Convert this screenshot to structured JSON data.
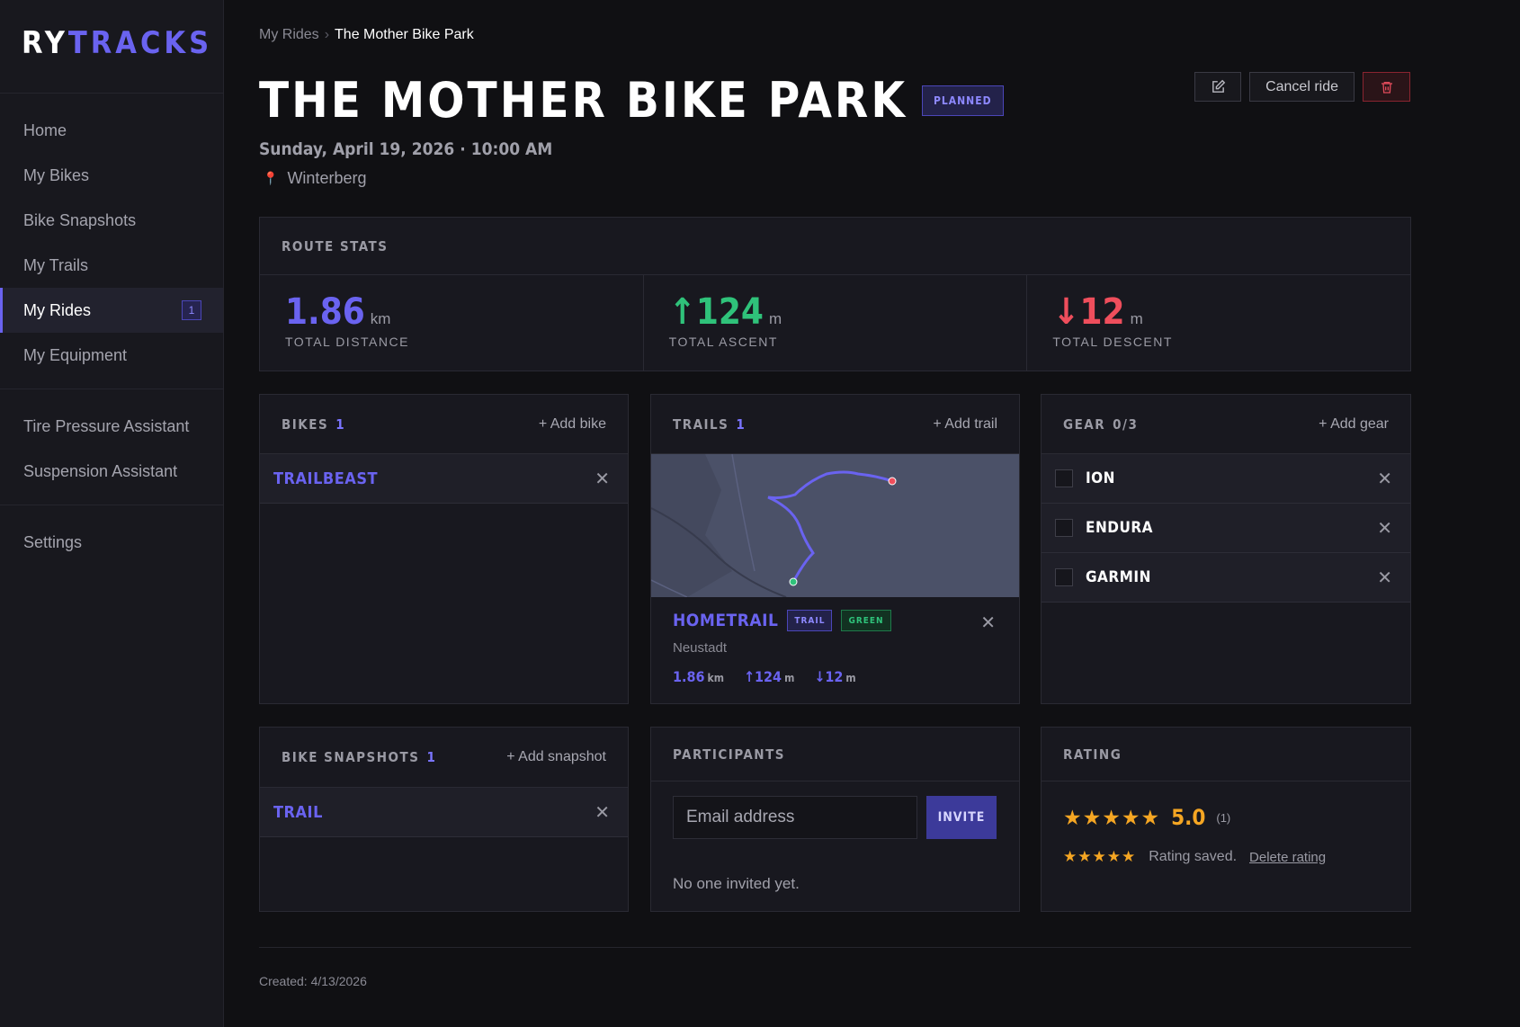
{
  "app": {
    "logo_part1": "RY",
    "logo_part2": "TRACKS"
  },
  "sidebar": {
    "items": [
      {
        "label": "Home"
      },
      {
        "label": "My Bikes"
      },
      {
        "label": "Bike Snapshots"
      },
      {
        "label": "My Trails"
      },
      {
        "label": "My Rides",
        "badge": "1",
        "active": true
      },
      {
        "label": "My Equipment"
      },
      {
        "label": "Tire Pressure Assistant"
      },
      {
        "label": "Suspension Assistant"
      },
      {
        "label": "Settings"
      }
    ]
  },
  "breadcrumb": {
    "parent": "My Rides",
    "separator": "›",
    "current": "The Mother Bike Park"
  },
  "ride": {
    "title": "THE MOTHER BIKE PARK",
    "status": "PLANNED",
    "date": "Sunday, April 19, 2026 · 10:00 AM",
    "location": "Winterberg"
  },
  "actions": {
    "cancel_label": "Cancel ride",
    "edit_icon": "edit-icon",
    "delete_icon": "trash-icon"
  },
  "route_stats": {
    "title": "ROUTE STATS",
    "distance": {
      "value": "1.86",
      "unit": "km",
      "label": "TOTAL DISTANCE"
    },
    "ascent": {
      "arrow": "↑",
      "value": "124",
      "unit": "m",
      "label": "TOTAL ASCENT"
    },
    "descent": {
      "arrow": "↓",
      "value": "12",
      "unit": "m",
      "label": "TOTAL DESCENT"
    }
  },
  "bikes": {
    "title": "BIKES",
    "count": "1",
    "add_label": "+ Add bike",
    "items": [
      {
        "name": "TRAILBEAST"
      }
    ]
  },
  "trails": {
    "title": "TRAILS",
    "count": "1",
    "add_label": "+ Add trail",
    "items": [
      {
        "name": "HOMETRAIL",
        "tag_type": "TRAIL",
        "tag_difficulty": "GREEN",
        "location": "Neustadt",
        "distance": "1.86",
        "distance_unit": "km",
        "ascent": "↑124",
        "ascent_unit": "m",
        "descent": "↓12",
        "descent_unit": "m"
      }
    ]
  },
  "gear": {
    "title": "GEAR",
    "count": "0/3",
    "add_label": "+ Add gear",
    "items": [
      {
        "name": "ION",
        "checked": false
      },
      {
        "name": "ENDURA",
        "checked": false
      },
      {
        "name": "GARMIN",
        "checked": false
      }
    ]
  },
  "snapshots": {
    "title": "BIKE SNAPSHOTS",
    "count": "1",
    "add_label": "+ Add snapshot",
    "items": [
      {
        "name": "TRAIL"
      }
    ]
  },
  "participants": {
    "title": "PARTICIPANTS",
    "email_placeholder": "Email address",
    "invite_label": "INVITE",
    "empty_text": "No one invited yet."
  },
  "rating": {
    "title": "RATING",
    "stars": "★★★★★",
    "score": "5.0",
    "count": "(1)",
    "user_stars": "★★★★★",
    "saved_text": "Rating saved.",
    "delete_label": "Delete rating"
  },
  "footer": {
    "created": "Created: 4/13/2026"
  },
  "colors": {
    "accent": "#6a63f0",
    "ascent": "#2fc27a",
    "descent": "#ef4e5c",
    "star": "#f5a623"
  }
}
